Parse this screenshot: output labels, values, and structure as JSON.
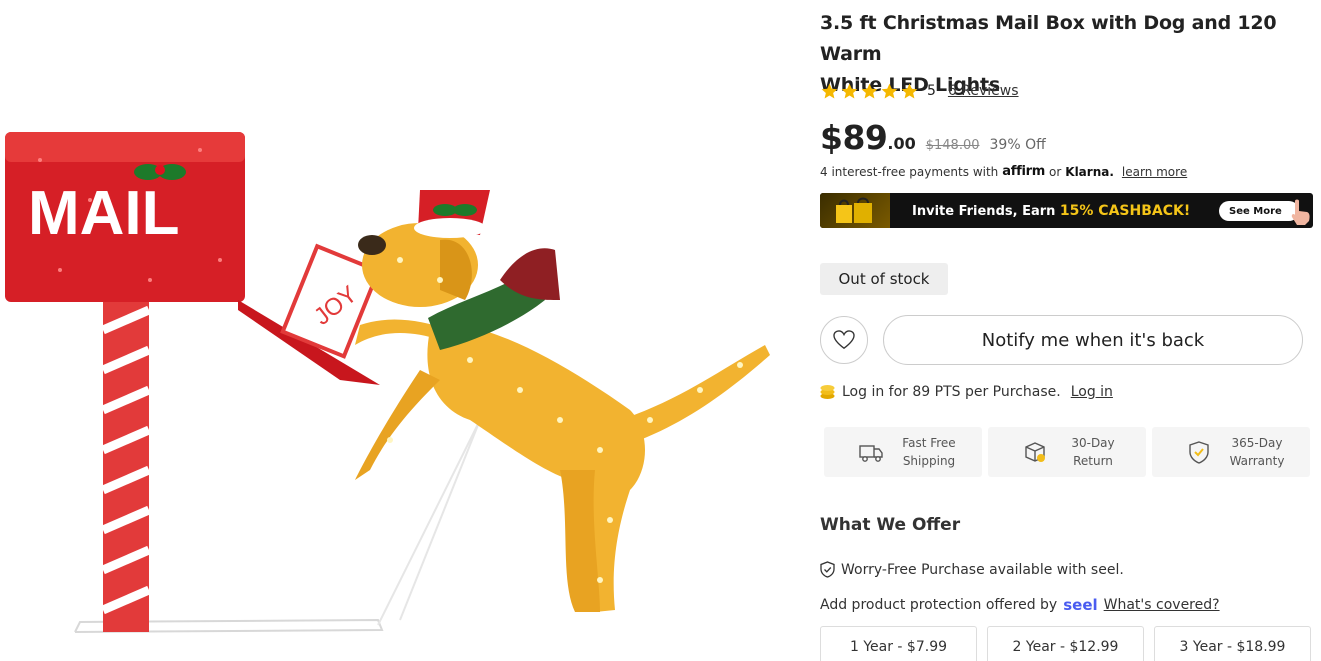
{
  "product": {
    "title_line1": "3.5 ft Christmas Mail Box with Dog and 120 Warm",
    "title_line2": "White LED Lights",
    "rating": 5,
    "rating_display": "5",
    "reviews_label": "6 Reviews",
    "image_alt_mail_text": "MAIL",
    "image_alt_card_text": "JOY"
  },
  "price": {
    "current_int": "$89",
    "current_cents": ".00",
    "original": "$148.00",
    "discount": "39% Off"
  },
  "financing": {
    "prefix": "4 interest-free payments with",
    "affirm": "affirm",
    "connector": "or",
    "klarna": "Klarna.",
    "learn_more": "learn more"
  },
  "cashback_banner": {
    "text_before": "Invite Friends, Earn ",
    "highlight": "15% CASHBACK!",
    "button": "See More",
    "highlight_color": "#f5c518"
  },
  "stock_status": "Out of stock",
  "actions": {
    "notify_label": "Notify me when it's back",
    "wishlist_icon": "heart-icon"
  },
  "points": {
    "text": "Log in for 89 PTS per Purchase.",
    "login_link": "Log in"
  },
  "features": [
    {
      "icon": "truck-icon",
      "line1": "Fast Free",
      "line2": "Shipping"
    },
    {
      "icon": "box-return-icon",
      "line1": "30-Day",
      "line2": "Return"
    },
    {
      "icon": "shield-check-icon",
      "line1": "365-Day",
      "line2": "Warranty"
    }
  ],
  "offer": {
    "heading": "What We Offer",
    "worry_free": "Worry-Free Purchase available with seel.",
    "protection_prefix": "Add product protection offered by",
    "seel_logo": "seel",
    "whats_covered": "What's covered?",
    "plans": [
      "1 Year - $7.99",
      "2 Year - $12.99",
      "3 Year - $18.99"
    ]
  },
  "colors": {
    "star": "#f5b800",
    "seel_brand": "#4a5cf0",
    "mailbox_red": "#d61f26"
  }
}
